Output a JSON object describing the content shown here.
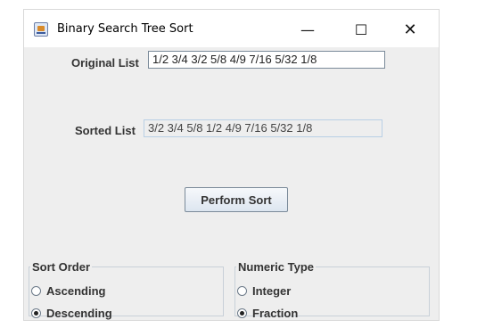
{
  "window": {
    "title": "Binary Search Tree Sort",
    "minimize_glyph": "—",
    "maximize_glyph": "☐",
    "close_glyph": "✕"
  },
  "original": {
    "label": "Original List",
    "value": "1/2 3/4 3/2 5/8 4/9 7/16 5/32 1/8"
  },
  "sorted": {
    "label": "Sorted List",
    "value": "3/2 3/4 5/8 1/2 4/9 7/16 5/32 1/8"
  },
  "sort_button": {
    "label": "Perform Sort"
  },
  "sort_order": {
    "title": "Sort Order",
    "options": [
      {
        "label": "Ascending",
        "selected": false
      },
      {
        "label": "Descending",
        "selected": true
      }
    ]
  },
  "numeric_type": {
    "title": "Numeric Type",
    "options": [
      {
        "label": "Integer",
        "selected": false
      },
      {
        "label": "Fraction",
        "selected": true
      }
    ]
  }
}
